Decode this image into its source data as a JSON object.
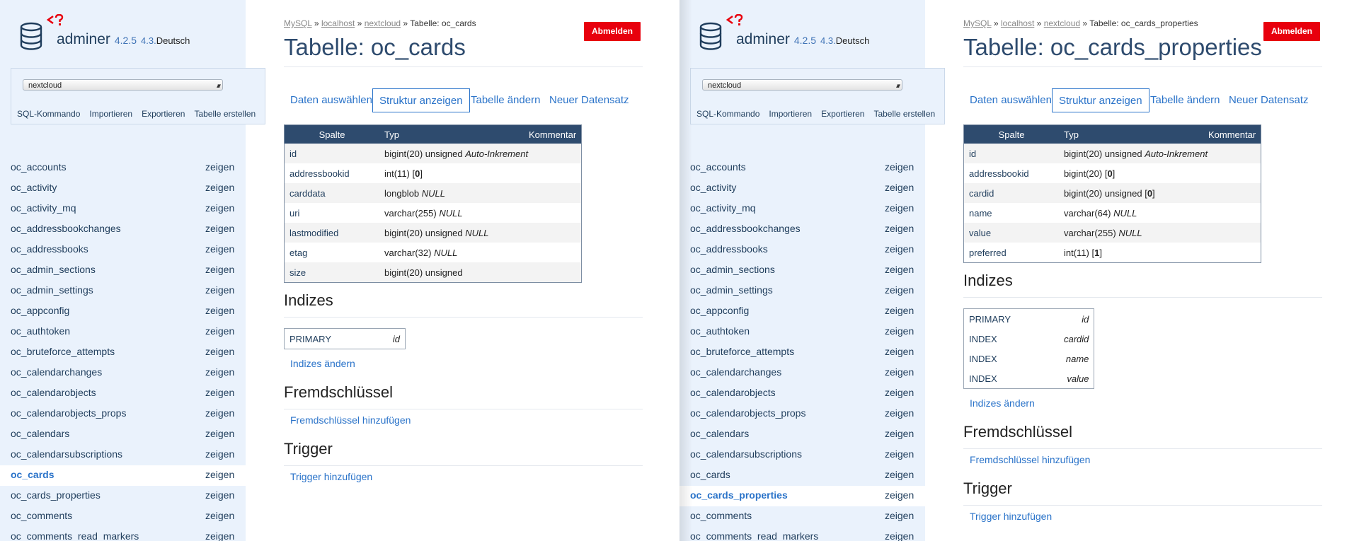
{
  "app": {
    "name": "adminer",
    "version": "4.2.5",
    "version_new": "4.3.",
    "language": "Deutsch"
  },
  "colors": {
    "accent": "#2a73c9",
    "header": "#2e4b6e",
    "logout": "#e8000d",
    "sidebar": "#eaf2fc"
  },
  "icons": {
    "logo": "database-icon",
    "logo_tag": "code-question-icon",
    "select_arrow": "select-arrows-icon"
  },
  "left": {
    "sidebar": {
      "db_select": "nextcloud",
      "links": [
        "SQL-Kommando",
        "Importieren",
        "Exportieren",
        "Tabelle erstellen"
      ],
      "zeigen": "zeigen",
      "tables": [
        "oc_accounts",
        "oc_activity",
        "oc_activity_mq",
        "oc_addressbookchanges",
        "oc_addressbooks",
        "oc_admin_sections",
        "oc_admin_settings",
        "oc_appconfig",
        "oc_authtoken",
        "oc_bruteforce_attempts",
        "oc_calendarchanges",
        "oc_calendarobjects",
        "oc_calendarobjects_props",
        "oc_calendars",
        "oc_calendarsubscriptions",
        "oc_cards",
        "oc_cards_properties",
        "oc_comments",
        "oc_comments_read_markers"
      ],
      "active_table": "oc_cards"
    },
    "breadcrumb": {
      "mysql": "MySQL",
      "sep": "»",
      "host": "localhost",
      "db": "nextcloud",
      "current": "Tabelle: oc_cards"
    },
    "logout": "Abmelden",
    "title": "Tabelle: oc_cards",
    "tabs": [
      "Daten auswählen",
      "Struktur anzeigen",
      "Tabelle ändern",
      "Neuer Datensatz"
    ],
    "columns_header": {
      "name": "Spalte",
      "type": "Typ",
      "comment": "Kommentar"
    },
    "columns": [
      {
        "name": "id",
        "type": "bigint(20) unsigned",
        "note": "Auto-Inkrement",
        "default": ""
      },
      {
        "name": "addressbookid",
        "type": "int(11)",
        "note": "",
        "default": "0"
      },
      {
        "name": "carddata",
        "type": "longblob",
        "note": "NULL",
        "default": ""
      },
      {
        "name": "uri",
        "type": "varchar(255)",
        "note": "NULL",
        "default": ""
      },
      {
        "name": "lastmodified",
        "type": "bigint(20) unsigned",
        "note": "NULL",
        "default": ""
      },
      {
        "name": "etag",
        "type": "varchar(32)",
        "note": "NULL",
        "default": ""
      },
      {
        "name": "size",
        "type": "bigint(20) unsigned",
        "note": "",
        "default": ""
      }
    ],
    "indexes_title": "Indizes",
    "indexes": [
      {
        "kind": "PRIMARY",
        "col": "id"
      }
    ],
    "indexes_link": "Indizes ändern",
    "fk_title": "Fremdschlüssel",
    "fk_link": "Fremdschlüssel hinzufügen",
    "trigger_title": "Trigger",
    "trigger_link": "Trigger hinzufügen"
  },
  "right": {
    "sidebar": {
      "db_select": "nextcloud",
      "links": [
        "SQL-Kommando",
        "Importieren",
        "Exportieren",
        "Tabelle erstellen"
      ],
      "zeigen": "zeigen",
      "tables": [
        "oc_accounts",
        "oc_activity",
        "oc_activity_mq",
        "oc_addressbookchanges",
        "oc_addressbooks",
        "oc_admin_sections",
        "oc_admin_settings",
        "oc_appconfig",
        "oc_authtoken",
        "oc_bruteforce_attempts",
        "oc_calendarchanges",
        "oc_calendarobjects",
        "oc_calendarobjects_props",
        "oc_calendars",
        "oc_calendarsubscriptions",
        "oc_cards",
        "oc_cards_properties",
        "oc_comments",
        "oc_comments_read_markers"
      ],
      "active_table": "oc_cards_properties"
    },
    "breadcrumb": {
      "mysql": "MySQL",
      "sep": "»",
      "host": "localhost",
      "db": "nextcloud",
      "current": "Tabelle: oc_cards_properties"
    },
    "logout": "Abmelden",
    "title": "Tabelle: oc_cards_properties",
    "tabs": [
      "Daten auswählen",
      "Struktur anzeigen",
      "Tabelle ändern",
      "Neuer Datensatz"
    ],
    "columns_header": {
      "name": "Spalte",
      "type": "Typ",
      "comment": "Kommentar"
    },
    "columns": [
      {
        "name": "id",
        "type": "bigint(20) unsigned",
        "note": "Auto-Inkrement",
        "default": ""
      },
      {
        "name": "addressbookid",
        "type": "bigint(20)",
        "note": "",
        "default": "0"
      },
      {
        "name": "cardid",
        "type": "bigint(20) unsigned",
        "note": "",
        "default": "0"
      },
      {
        "name": "name",
        "type": "varchar(64)",
        "note": "NULL",
        "default": ""
      },
      {
        "name": "value",
        "type": "varchar(255)",
        "note": "NULL",
        "default": ""
      },
      {
        "name": "preferred",
        "type": "int(11)",
        "note": "",
        "default": "1"
      }
    ],
    "indexes_title": "Indizes",
    "indexes": [
      {
        "kind": "PRIMARY",
        "col": "id"
      },
      {
        "kind": "INDEX",
        "col": "cardid"
      },
      {
        "kind": "INDEX",
        "col": "name"
      },
      {
        "kind": "INDEX",
        "col": "value"
      }
    ],
    "indexes_link": "Indizes ändern",
    "fk_title": "Fremdschlüssel",
    "fk_link": "Fremdschlüssel hinzufügen",
    "trigger_title": "Trigger",
    "trigger_link": "Trigger hinzufügen"
  }
}
